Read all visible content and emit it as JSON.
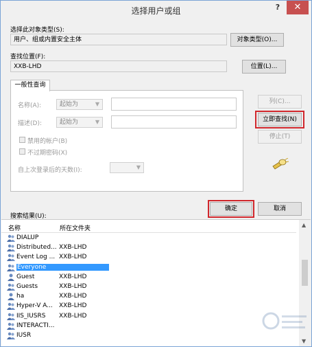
{
  "window": {
    "title": "选择用户或组",
    "help": "?",
    "close": "✕"
  },
  "object_type": {
    "label": "选择此对象类型(S):",
    "value": "用户、组或内置安全主体",
    "button": "对象类型(O)..."
  },
  "location": {
    "label": "查找位置(F):",
    "value": "XXB-LHD",
    "button": "位置(L)..."
  },
  "tab": {
    "label": "一般性查询"
  },
  "query": {
    "name_label": "名称(A):",
    "name_mode": "起始为",
    "desc_label": "描述(D):",
    "desc_mode": "起始为",
    "disabled_accounts": "禁用的帐户(B)",
    "no_expire_pwd": "不过期密码(X)",
    "days_since_login": "自上次登录后的天数(I):"
  },
  "side_buttons": {
    "columns": "列(C)...",
    "find_now": "立即查找(N)",
    "stop": "停止(T)"
  },
  "results_label": "搜索结果(U):",
  "ok": "确定",
  "cancel": "取消",
  "results": {
    "headers": {
      "name": "名称",
      "folder": "所在文件夹"
    },
    "rows": [
      {
        "name": "DIALUP",
        "folder": ""
      },
      {
        "name": "Distributed...",
        "folder": "XXB-LHD"
      },
      {
        "name": "Event Log ...",
        "folder": "XXB-LHD"
      },
      {
        "name": "Everyone",
        "folder": ""
      },
      {
        "name": "Guest",
        "folder": "XXB-LHD"
      },
      {
        "name": "Guests",
        "folder": "XXB-LHD"
      },
      {
        "name": "ha",
        "folder": "XXB-LHD"
      },
      {
        "name": "Hyper-V A...",
        "folder": "XXB-LHD"
      },
      {
        "name": "IIS_IUSRS",
        "folder": "XXB-LHD"
      },
      {
        "name": "INTERACTI...",
        "folder": ""
      },
      {
        "name": "IUSR",
        "folder": ""
      }
    ],
    "selected_index": 3
  },
  "colors": {
    "highlight": "#d0262b",
    "selection": "#3399ff",
    "close": "#c75050"
  }
}
